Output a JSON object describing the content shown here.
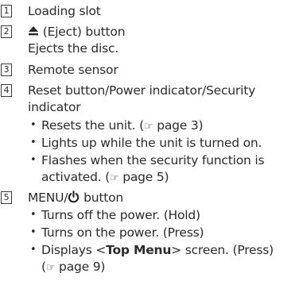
{
  "items": [
    {
      "number": "1",
      "title": "Loading slot"
    },
    {
      "number": "2",
      "icon": "eject-icon",
      "title_rest": "(Eject) button",
      "desc": "Ejects the disc."
    },
    {
      "number": "3",
      "title": "Remote sensor"
    },
    {
      "number": "4",
      "title_line1": "Reset button/Power indicator/Security",
      "title_line2": "indicator",
      "bullets": [
        {
          "text_a": "Resets the unit. (",
          "hand": "☞",
          "text_b": " page 3)"
        },
        {
          "text": "Lights up while the unit is turned on."
        },
        {
          "text_a": "Flashes when the security function is",
          "text_c": "activated. (",
          "hand": "☞",
          "text_b": " page 5)"
        }
      ]
    },
    {
      "number": "5",
      "title_a": "MENU/",
      "icon": "power-icon",
      "title_b": " button",
      "bullets": [
        {
          "text": "Turns off the power. (Hold)"
        },
        {
          "text": "Turns on the power. (Press)"
        },
        {
          "text_a": "Displays <",
          "bold": "Top Menu",
          "text_b": "> screen. (Press)",
          "text_c": "(",
          "hand": "☞",
          "text_d": " page 9)"
        }
      ]
    }
  ],
  "bullet_char": "•"
}
